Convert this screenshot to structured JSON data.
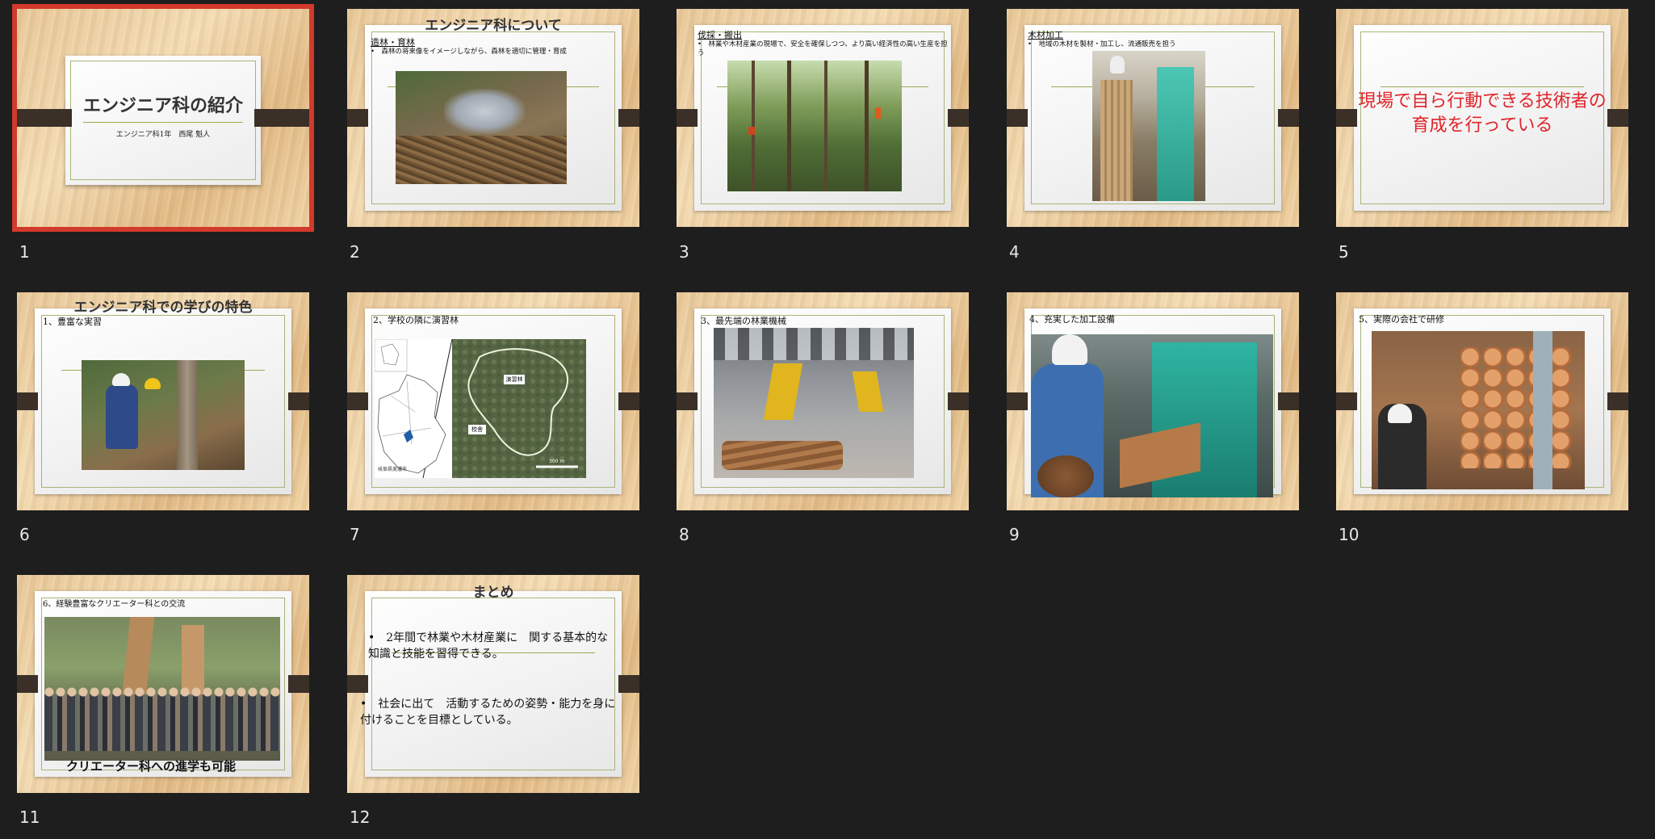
{
  "slides": [
    {
      "num": "1",
      "title": "エンジニア科の紹介",
      "subtitle": "エンジニア科1年　西尾 魁人"
    },
    {
      "num": "2",
      "title": "エンジニア科について",
      "heading": "造林・育林",
      "bullet": "•　森林の将来像をイメージしながら、森林を適切に管理・育成"
    },
    {
      "num": "3",
      "heading": "伐採・搬出",
      "bullet": "•　林業や木材産業の現場で、安全を確保しつつ、より高い経済性の高い生産を担う"
    },
    {
      "num": "4",
      "heading": "木材加工",
      "bullet": "•　地域の木材を製材・加工し、流通販売を担う"
    },
    {
      "num": "5",
      "text_line1": "現場で自ら行動できる技術者の",
      "text_line2": "育成を行っている"
    },
    {
      "num": "6",
      "title": "エンジニア科での学びの特色",
      "heading": "1、豊富な実習"
    },
    {
      "num": "7",
      "heading": "2、学校の隣に演習林",
      "map_label_forest": "演習林",
      "map_label_school": "校舎",
      "map_label_city": "岐阜県美濃市",
      "map_scale": "300 m"
    },
    {
      "num": "8",
      "heading": "3、最先端の林業機械"
    },
    {
      "num": "9",
      "heading": "4、充実した加工設備"
    },
    {
      "num": "10",
      "heading": "5、実際の会社で研修"
    },
    {
      "num": "11",
      "heading": "6、経験豊富なクリエーター科との交流",
      "caption": "クリエーター科への進学も可能"
    },
    {
      "num": "12",
      "title": "まとめ",
      "bullet1": "•　2年間で林業や木材産業に　関する基本的な知識と技能を習得できる。",
      "bullet2": "•　社会に出て　活動するための姿勢・能力を身に付けることを目標としている。"
    }
  ],
  "colors": {
    "selection": "#d23a2b",
    "accent_red": "#e0242a",
    "background": "#1e1e1e"
  }
}
